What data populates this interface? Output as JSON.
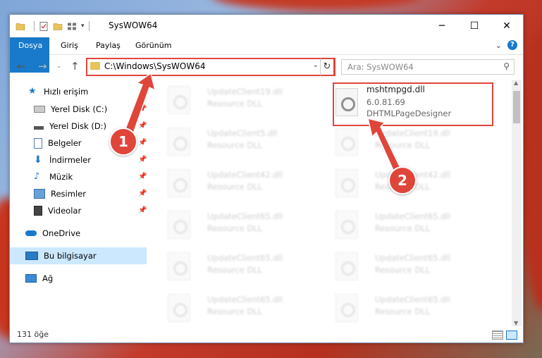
{
  "window": {
    "title": "SysWOW64",
    "minimize": "─",
    "maximize": "☐",
    "close": "✕"
  },
  "ribbon": {
    "tabs": [
      "Dosya",
      "Giriş",
      "Paylaş",
      "Görünüm"
    ],
    "expand": "⌄",
    "help": "?"
  },
  "address": {
    "path": "C:\\Windows\\SysWOW64",
    "search_placeholder": "Ara: SysWOW64"
  },
  "nav": {
    "quick_access": "Hızlı erişim",
    "items": [
      "Yerel Disk (C:)",
      "Yerel Disk (D:)",
      "Belgeler",
      "İndirmeler",
      "Müzik",
      "Resimler",
      "Videolar"
    ],
    "onedrive": "OneDrive",
    "this_pc": "Bu bilgisayar",
    "network": "Ağ"
  },
  "files": {
    "left": [
      {
        "name": "UpdateClient19.dll",
        "desc": "Resource DLL"
      },
      {
        "name": "UpdateClient5.dll",
        "desc": "Resource DLL"
      },
      {
        "name": "UpdateClient42.dll",
        "desc": "Resource DLL"
      },
      {
        "name": "UpdateClient65.dll",
        "desc": "Resource DLL"
      },
      {
        "name": "UpdateClient65.dll",
        "desc": "Resource DLL"
      },
      {
        "name": "UpdateClient65.dll",
        "desc": "Resource DLL"
      }
    ],
    "right": [
      {
        "name": "UpdateClient19.dll",
        "desc": "Resource DLL"
      },
      {
        "name": "UpdateClient42.dll",
        "desc": "Resource DLL"
      },
      {
        "name": "UpdateClient65.dll",
        "desc": "Resource DLL"
      },
      {
        "name": "UpdateClient65.dll",
        "desc": "Resource DLL"
      },
      {
        "name": "UpdateClient65.dll",
        "desc": "Resource DLL"
      }
    ],
    "highlight": {
      "name": "mshtmpgd.dll",
      "version": "6.0.81.69",
      "desc": "DHTMLPageDesigner"
    }
  },
  "status": {
    "count": "131 öğe"
  },
  "callouts": [
    "1",
    "2"
  ],
  "colors": {
    "accent": "#1979ca",
    "callout": "#e0453a",
    "selected": "#cce8ff"
  }
}
